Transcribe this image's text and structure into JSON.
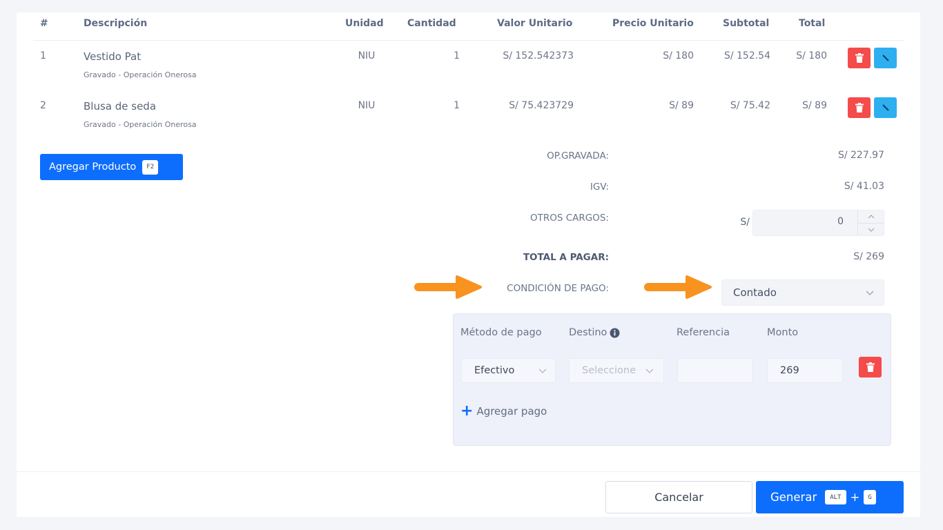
{
  "table": {
    "headers": {
      "num": "#",
      "descripcion": "Descripción",
      "unidad": "Unidad",
      "cantidad": "Cantidad",
      "valor_unitario": "Valor Unitario",
      "precio_unitario": "Precio Unitario",
      "subtotal": "Subtotal",
      "total": "Total"
    },
    "rows": [
      {
        "num": "1",
        "descripcion": "Vestido Pat",
        "afectacion": "Gravado - Operación Onerosa",
        "unidad": "NIU",
        "cantidad": "1",
        "valor_unitario": "S/ 152.542373",
        "precio_unitario": "S/ 180",
        "subtotal": "S/ 152.54",
        "total": "S/ 180"
      },
      {
        "num": "2",
        "descripcion": "Blusa de seda",
        "afectacion": "Gravado - Operación Onerosa",
        "unidad": "NIU",
        "cantidad": "1",
        "valor_unitario": "S/ 75.423729",
        "precio_unitario": "S/ 89",
        "subtotal": "S/ 75.42",
        "total": "S/ 89"
      }
    ]
  },
  "add_product": {
    "label": "Agregar Producto",
    "shortcut": "F2"
  },
  "totals": {
    "op_gravada_label": "OP.GRAVADA:",
    "op_gravada_value": "S/ 227.97",
    "igv_label": "IGV:",
    "igv_value": "S/ 41.03",
    "otros_cargos_label": "OTROS CARGOS:",
    "otros_cargos_currency": "S/",
    "otros_cargos_value": "0",
    "total_label": "TOTAL A PAGAR:",
    "total_value": "S/ 269"
  },
  "condicion": {
    "label": "CONDICIÓN DE PAGO:",
    "value": "Contado"
  },
  "pagos": {
    "headers": {
      "metodo": "Método de pago",
      "destino": "Destino",
      "referencia": "Referencia",
      "monto": "Monto"
    },
    "metodo_value": "Efectivo",
    "destino_placeholder": "Seleccione",
    "referencia_value": "",
    "monto_value": "269",
    "add_label": "Agregar pago"
  },
  "footer": {
    "cancel_label": "Cancelar",
    "generate_label": "Generar",
    "generate_key1": "ALT",
    "generate_plus": "+",
    "generate_key2": "G"
  },
  "colors": {
    "primary": "#0d6efd",
    "danger": "#f44b4b",
    "info": "#2eaff0",
    "annotation_arrow": "#f7931e"
  },
  "icons": [
    "trash-icon",
    "pencil-icon",
    "info-icon",
    "chevron-down-icon",
    "chevron-up-icon",
    "plus-icon",
    "annotation-arrow"
  ]
}
